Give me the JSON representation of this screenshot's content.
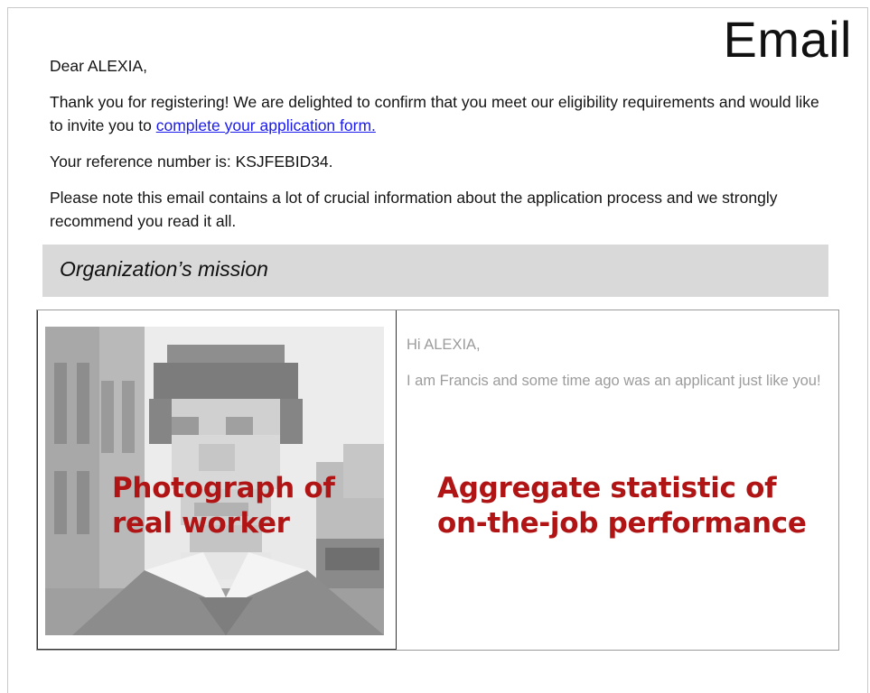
{
  "header": {
    "title": "Email"
  },
  "letter": {
    "greeting": "Dear ALEXIA,",
    "paragraph1_text": "Thank you for registering! We are delighted to confirm that you meet our eligibility requirements and would like to invite you to ",
    "paragraph1_link": "complete your application form.",
    "reference_line": "Your reference number is: KSJFEBID34.",
    "notice": "Please note this email contains a lot of crucial information about the application process and we strongly recommend you read it all."
  },
  "mission": {
    "label": "Organization’s mission"
  },
  "card": {
    "photo": {
      "label": "Photograph of real worker"
    },
    "message": {
      "greeting": "Hi ALEXIA,",
      "body": "I am Francis and some time ago was an applicant just like you!"
    },
    "statistic": {
      "label": "Aggregate statistic of on-the-job performance"
    }
  },
  "colors": {
    "link": "#1a1aee",
    "annotation_red": "#b01414",
    "mission_bar": "#d9d9d9",
    "faded_text": "#9c9c9c"
  }
}
